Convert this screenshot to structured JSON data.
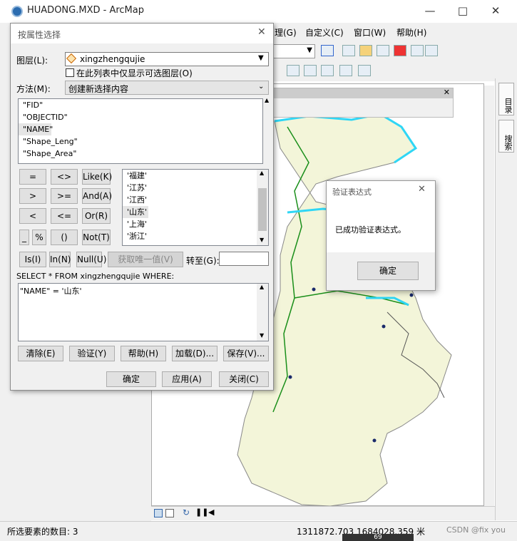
{
  "app": {
    "title": "HUADONG.MXD - ArcMap",
    "menus": [
      "理(G)",
      "自定义(C)",
      "窗口(W)",
      "帮助(H)"
    ],
    "status_text": "所选要素的数目: 3",
    "coords": "1311872.703  1684028.359 米",
    "watermark": "CSDN @fix you",
    "right_tabs": [
      "目录",
      "搜索"
    ],
    "bottom_number": "69"
  },
  "dialog": {
    "title": "按属性选择",
    "layer_label": "图层(L):",
    "layer_value": "xingzhengqujie",
    "only_selectable_label": "在此列表中仅显示可选图层(O)",
    "method_label": "方法(M):",
    "method_value": "创建新选择内容",
    "fields": [
      "\"FID\"",
      "\"OBJECTID\"",
      "\"NAME\"",
      "\"Shape_Leng\"",
      "\"Shape_Area\""
    ],
    "operators": [
      [
        "=",
        "<>",
        "Like(K)"
      ],
      [
        ">",
        ">=",
        "And(A)"
      ],
      [
        "<",
        "<=",
        "Or(R)"
      ],
      [
        "_",
        "%",
        "()",
        "Not(T)"
      ]
    ],
    "values": [
      "'福建'",
      "'江苏'",
      "'江西'",
      "'山东'",
      "'上海'",
      "'浙江'"
    ],
    "is_btn": "Is(I)",
    "in_btn": "In(N)",
    "null_btn": "Null(U)",
    "get_unique_btn": "获取唯一值(V)",
    "goto_label": "转至(G):",
    "sql_prefix": "SELECT * FROM xingzhengqujie WHERE:",
    "sql_expression": "\"NAME\" = '山东'",
    "clear_btn": "清除(E)",
    "verify_btn": "验证(Y)",
    "help_btn": "帮助(H)",
    "load_btn": "加载(D)...",
    "save_btn": "保存(V)...",
    "ok_btn": "确定",
    "apply_btn": "应用(A)",
    "close_btn": "关闭(C)"
  },
  "popup": {
    "title": "验证表达式",
    "message": "已成功验证表达式。",
    "ok_btn": "确定"
  }
}
